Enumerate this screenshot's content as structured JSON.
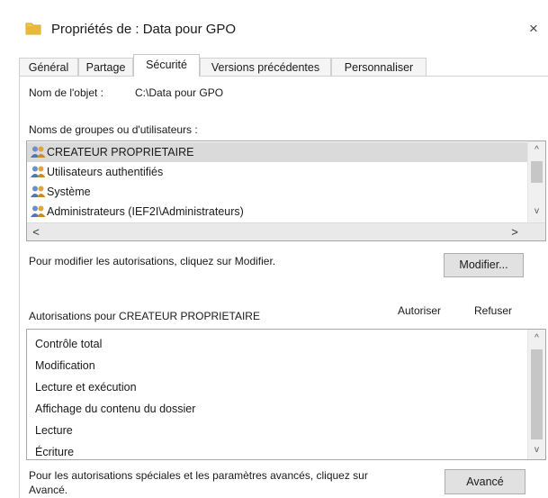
{
  "window": {
    "title": "Propriétés de : Data pour GPO",
    "close_glyph": "×"
  },
  "tabs": [
    {
      "label": "Général",
      "active": false
    },
    {
      "label": "Partage",
      "active": false
    },
    {
      "label": "Sécurité",
      "active": true
    },
    {
      "label": "Versions précédentes",
      "active": false
    },
    {
      "label": "Personnaliser",
      "active": false
    }
  ],
  "object": {
    "label": "Nom de l'objet :",
    "value": "C:\\Data pour GPO"
  },
  "groups": {
    "label": "Noms de groupes ou d'utilisateurs :",
    "items": [
      {
        "name": "CREATEUR PROPRIETAIRE",
        "selected": true
      },
      {
        "name": "Utilisateurs authentifiés",
        "selected": false
      },
      {
        "name": "Système",
        "selected": false
      },
      {
        "name": "Administrateurs (IEF2I\\Administrateurs)",
        "selected": false
      }
    ],
    "scroll_up": "^",
    "scroll_down": "v",
    "scroll_left": "<",
    "scroll_right": ">"
  },
  "modify": {
    "text": "Pour modifier les autorisations, cliquez sur Modifier.",
    "button_label": "Modifier..."
  },
  "permissions": {
    "label": "Autorisations pour CREATEUR PROPRIETAIRE",
    "allow_header": "Autoriser",
    "deny_header": "Refuser",
    "items": [
      "Contrôle total",
      "Modification",
      "Lecture et exécution",
      "Affichage du contenu du dossier",
      "Lecture",
      "Écriture"
    ],
    "scroll_up": "^",
    "scroll_down": "v"
  },
  "advanced": {
    "text_line1": "Pour les autorisations spéciales et les paramètres avancés, cliquez sur",
    "text_line2": "Avancé.",
    "button_label": "Avancé"
  },
  "colors": {
    "folder": "#e8b83a",
    "focus_border": "#0078d7",
    "selection": "#dadada"
  }
}
